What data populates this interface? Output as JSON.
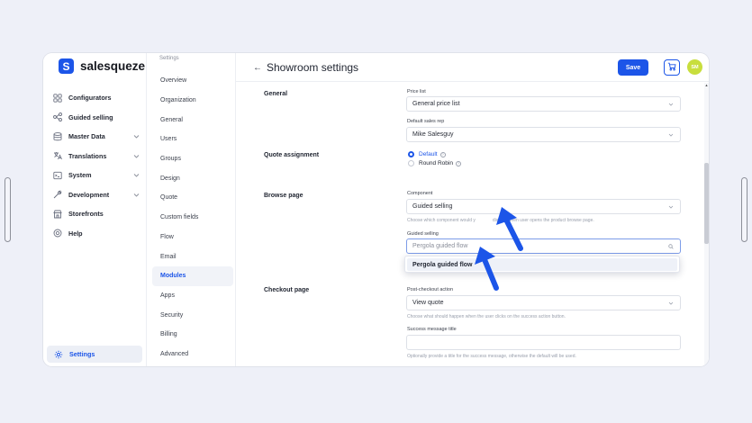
{
  "brand": {
    "logo_letter": "S",
    "name": "salesqueze",
    "accent": "#1c55e8"
  },
  "sidebar": {
    "items": [
      {
        "label": "Configurators",
        "icon": "grid-icon",
        "has_chevron": false
      },
      {
        "label": "Guided selling",
        "icon": "flow-icon",
        "has_chevron": false
      },
      {
        "label": "Master Data",
        "icon": "database-icon",
        "has_chevron": true
      },
      {
        "label": "Translations",
        "icon": "translate-icon",
        "has_chevron": true
      },
      {
        "label": "System",
        "icon": "terminal-icon",
        "has_chevron": true
      },
      {
        "label": "Development",
        "icon": "wrench-icon",
        "has_chevron": true
      },
      {
        "label": "Storefronts",
        "icon": "store-icon",
        "has_chevron": false
      },
      {
        "label": "Help",
        "icon": "help-icon",
        "has_chevron": false
      }
    ],
    "settings_label": "Settings"
  },
  "subnav": {
    "heading": "Settings",
    "items": [
      "Overview",
      "Organization",
      "General",
      "Users",
      "Groups",
      "Design",
      "Quote",
      "Custom fields",
      "Flow",
      "Email",
      "Modules",
      "Apps",
      "Security",
      "Billing",
      "Advanced"
    ],
    "active": "Modules"
  },
  "header": {
    "back": "←",
    "title": "Showroom settings",
    "save_label": "Save",
    "avatar_initials": "SM"
  },
  "sections": {
    "general": {
      "title": "General",
      "price_list_label": "Price list",
      "price_list_value": "General price list",
      "sales_rep_label": "Default sales rep",
      "sales_rep_value": "Mike Salesguy"
    },
    "quote": {
      "title": "Quote assignment",
      "option_default": "Default",
      "option_round_robin": "Round Robin",
      "selected": "Default"
    },
    "browse": {
      "title": "Browse page",
      "component_label": "Component",
      "component_value": "Guided selling",
      "component_help_before": "Choose which component would y",
      "component_help_after": "display when user opens the product browse page.",
      "guided_label": "Guided selling",
      "guided_placeholder": "Pergola guided flow",
      "dropdown_option": "Pergola guided flow"
    },
    "checkout": {
      "title": "Checkout page",
      "action_label": "Post-checkout action",
      "action_value": "View quote",
      "action_help": "Choose what should happen when the user clicks on the success action button.",
      "msg_title_label": "Success message title",
      "msg_title_help": "Optionally provide a title for the success message, otherwise the default will be used."
    }
  }
}
